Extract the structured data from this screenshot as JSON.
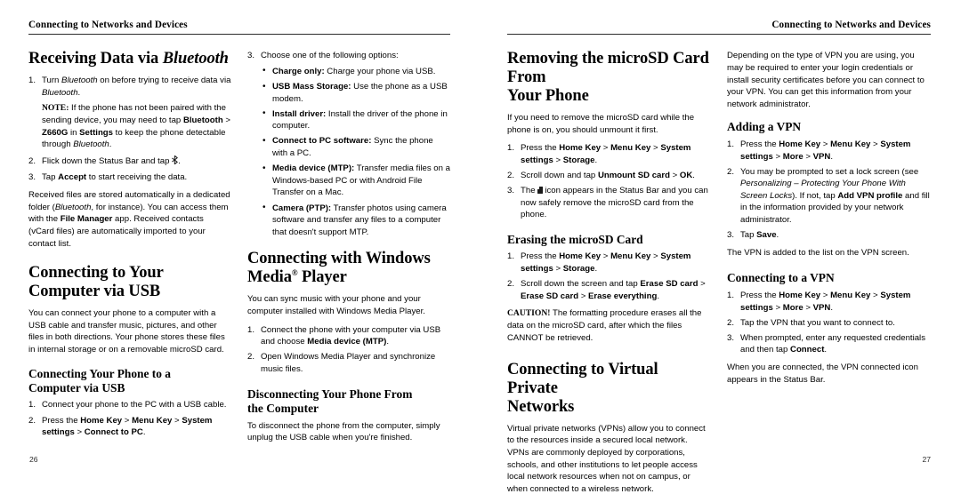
{
  "spread": {
    "left_page": {
      "running_head": "Connecting to Networks and Devices",
      "folio": "26",
      "col1": {
        "h_receiving": "Receiving Data via ",
        "h_receiving_ital": "Bluetooth",
        "step1_pre": "Turn ",
        "step1_ital1": "Bluetooth",
        "step1_mid": " on before trying to receive data via ",
        "step1_ital2": "Bluetooth",
        "step1_end": ".",
        "note_label": "NOTE:",
        "note_a": " If the phone has not been paired with the sending device, you may need to tap ",
        "note_b_bluetooth": "Bluetooth",
        "note_c": " > ",
        "note_d_z660g": "Z660G",
        "note_e": " in ",
        "note_f_settings": "Settings",
        "note_g": " to keep the phone detectable through ",
        "note_h_ital": "Bluetooth",
        "note_i": ".",
        "step2_a": "Flick down the Status Bar and tap ",
        "step2_b": ".",
        "step3_a": "Tap ",
        "step3_b_accept": "Accept",
        "step3_c": " to start receiving the data.",
        "para_a": "Received files are stored automatically in a dedicated folder (",
        "para_b_ital": "Bluetooth",
        "para_c": ", for instance). You can access them with the ",
        "para_d_bold": "File Manager",
        "para_e": " app. Received contacts (vCard files) are automatically imported to your contact list.",
        "h_connect_usb_l1": "Connecting to Your",
        "h_connect_usb_l2": "Computer via USB",
        "usb_para": "You can connect your phone to a computer with a USB cable and transfer music, pictures, and other files in both directions. Your phone stores these files in internal storage or on a removable microSD card.",
        "h_connect_phone_l1": "Connecting Your Phone to a",
        "h_connect_phone_l2": "Computer via USB",
        "cp_step1": "Connect your phone to the PC with a USB cable.",
        "cp_step2_a": "Press the ",
        "cp_step2_home": "Home Key",
        "cp_step2_gt1": " > ",
        "cp_step2_menu": "Menu Key",
        "cp_step2_gt2": " > ",
        "cp_step2_sys": "System settings",
        "cp_step2_gt3": " > ",
        "cp_step2_ctp": "Connect to PC",
        "cp_step2_end": "."
      },
      "col2": {
        "step3_lead": "Choose one of the following options:",
        "bullets": [
          {
            "label": "Charge only:",
            "text": " Charge your phone via USB."
          },
          {
            "label": "USB Mass Storage:",
            "text": " Use the phone as a USB modem."
          },
          {
            "label": "Install driver:",
            "text": " Install the driver of the phone in computer."
          },
          {
            "label": "Connect to PC software:",
            "text": " Sync the phone with a PC."
          },
          {
            "label": "Media device (MTP):",
            "text": " Transfer media files on a Windows-based PC or with Android File Transfer on a Mac."
          },
          {
            "label": "Camera (PTP):",
            "text": " Transfer photos using camera software and transfer any files to a computer that doesn't support MTP."
          }
        ],
        "h_wmp_l1": "Connecting with Windows",
        "h_wmp_l2_pre": "Media",
        "h_wmp_l2_sup": "®",
        "h_wmp_l2_post": " Player",
        "wmp_para": "You can sync music with your phone and your computer installed with Windows Media Player.",
        "wmp_step1_a": "Connect the phone with your computer via USB and choose ",
        "wmp_step1_b": "Media device (MTP)",
        "wmp_step1_c": ".",
        "wmp_step2": "Open Windows Media Player and synchronize music files.",
        "h_disconnect_l1": "Disconnecting Your Phone From",
        "h_disconnect_l2": "the Computer",
        "disconnect_para": "To disconnect the phone from the computer, simply unplug the USB cable when you're finished."
      }
    },
    "right_page": {
      "running_head": "Connecting to Networks and Devices",
      "folio": "27",
      "col1": {
        "h_removing_l1": "Removing the microSD Card From",
        "h_removing_l2": "Your Phone",
        "rm_para": "If you need to remove the microSD card while the phone is on, you should unmount it first.",
        "rm_step1_a": "Press the ",
        "rm_step1_home": "Home Key",
        "rm_step1_gt1": " > ",
        "rm_step1_menu": "Menu Key",
        "rm_step1_gt2": " > ",
        "rm_step1_sys": "System settings",
        "rm_step1_gt3": " > ",
        "rm_step1_storage": "Storage",
        "rm_step1_end": ".",
        "rm_step2_a": "Scroll down and tap ",
        "rm_step2_b": "Unmount SD card",
        "rm_step2_gt": " > ",
        "rm_step2_ok": "OK",
        "rm_step2_end": ".",
        "rm_step3_a": "The ",
        "rm_step3_b": " icon appears in the Status Bar and you can now safely remove the microSD card from the phone.",
        "h_erasing": "Erasing the microSD Card",
        "er_step1_a": "Press the ",
        "er_step1_home": "Home Key",
        "er_step1_gt1": " > ",
        "er_step1_menu": "Menu Key",
        "er_step1_gt2": " > ",
        "er_step1_sys": "System settings",
        "er_step1_gt3": " > ",
        "er_step1_storage": "Storage",
        "er_step1_end": ".",
        "er_step2_a": "Scroll down the screen and tap ",
        "er_step2_b": "Erase SD card",
        "er_step2_gt1": " > ",
        "er_step2_c": "Erase SD card",
        "er_step2_gt2": " > ",
        "er_step2_d": "Erase everything",
        "er_step2_end": ".",
        "caution_label": "CAUTION!",
        "caution_text": " The formatting procedure erases all the data on the microSD card, after which the files CANNOT be retrieved.",
        "h_vpn_l1": "Connecting to Virtual Private",
        "h_vpn_l2": "Networks",
        "vpn_para": "Virtual private networks (VPNs) allow you to connect to the resources inside a secured local network. VPNs are commonly deployed by corporations, schools, and other institutions to let people access local network resources when not on campus, or when connected to a wireless network."
      },
      "col2": {
        "vpn_para2": "Depending on the type of VPN you are using, you may be required to enter your login credentials or install security certificates before you can connect to your VPN. You can get this information from your network administrator.",
        "h_adding": "Adding a VPN",
        "ad_step1_a": "Press the ",
        "ad_step1_home": "Home Key",
        "ad_step1_gt1": " > ",
        "ad_step1_menu": "Menu Key",
        "ad_step1_gt2": " > ",
        "ad_step1_sys": "System settings",
        "ad_step1_gt3": " > ",
        "ad_step1_more": "More",
        "ad_step1_gt4": " > ",
        "ad_step1_vpn": "VPN",
        "ad_step1_end": ".",
        "ad_step2_a": "You may be prompted to set a lock screen (see ",
        "ad_step2_ital": "Personalizing – Protecting Your Phone With Screen Locks",
        "ad_step2_b": "). If not, tap ",
        "ad_step2_bold": "Add VPN profile",
        "ad_step2_c": " and fill in the information provided by your network administrator.",
        "ad_step3_a": "Tap ",
        "ad_step3_save": "Save",
        "ad_step3_end": ".",
        "ad_para": "The VPN is added to the list on the VPN screen.",
        "h_connecting_vpn": "Connecting to a VPN",
        "cv_step1_a": "Press the ",
        "cv_step1_home": "Home Key",
        "cv_step1_gt1": " > ",
        "cv_step1_menu": "Menu Key",
        "cv_step1_gt2": " > ",
        "cv_step1_sys": "System settings",
        "cv_step1_gt3": " > ",
        "cv_step1_more": "More",
        "cv_step1_gt4": " > ",
        "cv_step1_vpn": "VPN",
        "cv_step1_end": ".",
        "cv_step2": "Tap the VPN that you want to connect to.",
        "cv_step3_a": "When prompted, enter any requested credentials and then tap ",
        "cv_step3_connect": "Connect",
        "cv_step3_end": ".",
        "cv_para": "When you are connected, the VPN connected icon appears in the Status Bar."
      }
    },
    "numbering": {
      "n1": "1.",
      "n2": "2.",
      "n3": "3."
    }
  }
}
